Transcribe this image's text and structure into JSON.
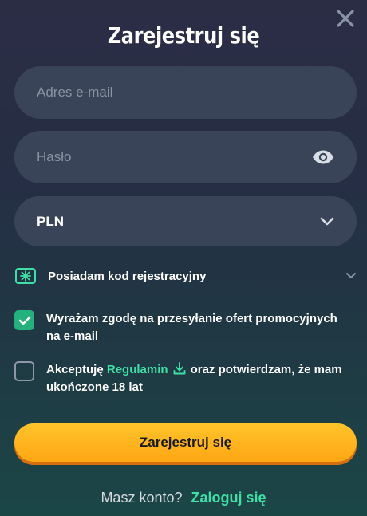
{
  "dialog": {
    "title": "Zarejestruj się",
    "close_icon": "close-icon"
  },
  "form": {
    "email": {
      "placeholder": "Adres e-mail",
      "value": ""
    },
    "password": {
      "placeholder": "Hasło",
      "value": "",
      "toggle_icon": "eye-icon"
    },
    "currency": {
      "value": "PLN",
      "icon": "chevron-down-icon"
    },
    "promo_code": {
      "label": "Posiadam kod rejestracyjny",
      "icon": "ticket-icon",
      "expand_icon": "chevron-down-icon"
    },
    "marketing_consent": {
      "checked": true,
      "text": "Wyrażam zgodę na przesyłanie ofert promocyjnych na e-mail"
    },
    "terms_consent": {
      "checked": false,
      "text_before": "Akceptuję",
      "link": "Regulamin",
      "link_icon": "download-icon",
      "text_after": "oraz potwierdzam, że mam ukończone 18 lat"
    },
    "submit_label": "Zarejestruj się"
  },
  "footer": {
    "prompt": "Masz konto?",
    "login_link": "Zaloguj się"
  },
  "colors": {
    "accent_green": "#3fe0a6",
    "checkbox_green": "#24b17e",
    "button_orange": "#ffb21c",
    "field_bg": "#3a4458"
  }
}
